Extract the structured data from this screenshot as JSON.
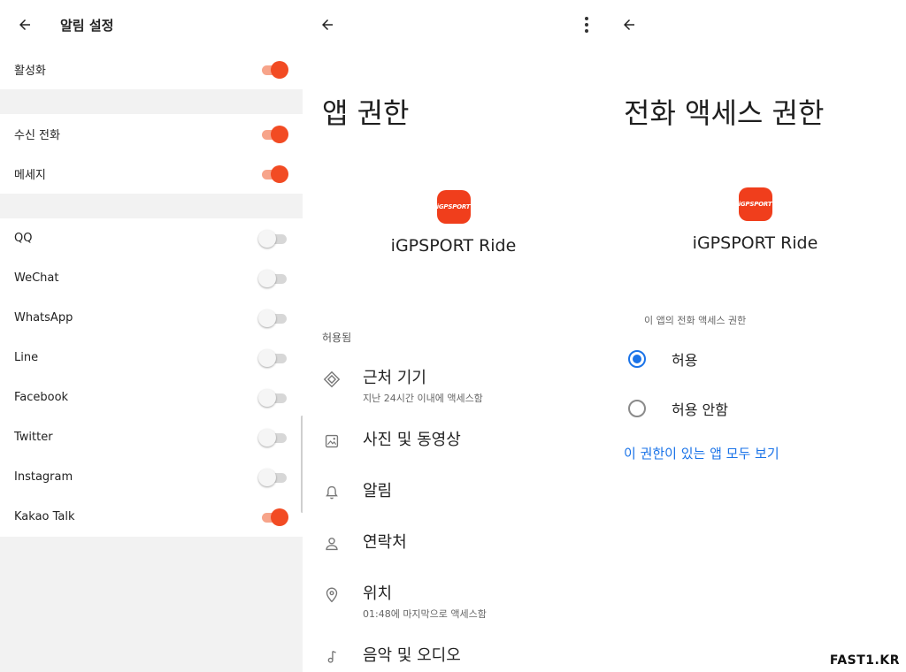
{
  "panel1": {
    "title": "알림 설정",
    "activate": {
      "label": "활성화",
      "on": true
    },
    "group2": [
      {
        "label": "수신 전화",
        "on": true
      },
      {
        "label": "메세지",
        "on": true
      }
    ],
    "apps": [
      {
        "label": "QQ",
        "on": false
      },
      {
        "label": "WeChat",
        "on": false
      },
      {
        "label": "WhatsApp",
        "on": false
      },
      {
        "label": "Line",
        "on": false
      },
      {
        "label": "Facebook",
        "on": false
      },
      {
        "label": "Twitter",
        "on": false
      },
      {
        "label": "Instagram",
        "on": false
      },
      {
        "label": "Kakao Talk",
        "on": true
      }
    ]
  },
  "panel2": {
    "title": "앱 권한",
    "logo_text": "iGPSPORT",
    "app_name": "iGPSPORT Ride",
    "section": "허용됨",
    "permissions": [
      {
        "title": "근처 기기",
        "subtitle": "지난 24시간 이내에 액세스함",
        "icon": "nearby-devices-icon"
      },
      {
        "title": "사진 및 동영상",
        "icon": "photos-icon"
      },
      {
        "title": "알림",
        "icon": "bell-icon"
      },
      {
        "title": "연락처",
        "icon": "person-icon"
      },
      {
        "title": "위치",
        "subtitle": "01:48에 마지막으로 액세스함",
        "icon": "location-pin-icon"
      },
      {
        "title": "음악 및 오디오",
        "icon": "music-note-icon"
      }
    ]
  },
  "panel3": {
    "title": "전화 액세스 권한",
    "logo_text": "iGPSPORT",
    "app_name": "iGPSPORT Ride",
    "subtitle": "이 앱의 전화 액세스 권한",
    "options": [
      {
        "label": "허용",
        "checked": true
      },
      {
        "label": "허용 안함",
        "checked": false
      }
    ],
    "link": "이 권한이 있는 앱 모두 보기"
  },
  "watermark": "FAST1.KR",
  "colors": {
    "toggle_on": "#f24b23",
    "toggle_on_track": "#f7a48a",
    "brand": "#f03e1c",
    "accent": "#1a73e8"
  }
}
